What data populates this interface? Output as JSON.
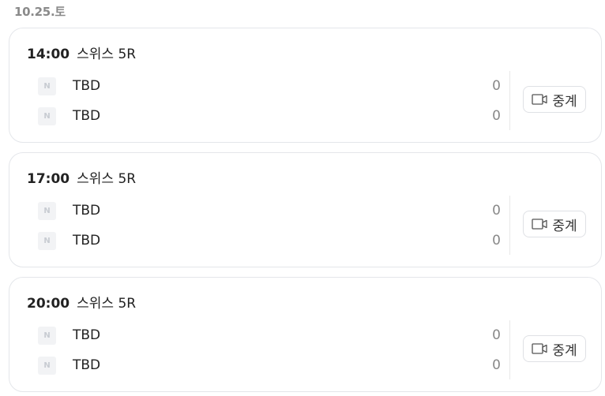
{
  "date": "10.25.토",
  "matches": [
    {
      "time": "14:00",
      "title": "스위스 5R",
      "teams": [
        {
          "logo_text": "N",
          "name": "TBD",
          "score": "0"
        },
        {
          "logo_text": "N",
          "name": "TBD",
          "score": "0"
        }
      ],
      "broadcast_label": "중계",
      "broadcast_icon": "video-camera-icon"
    },
    {
      "time": "17:00",
      "title": "스위스 5R",
      "teams": [
        {
          "logo_text": "N",
          "name": "TBD",
          "score": "0"
        },
        {
          "logo_text": "N",
          "name": "TBD",
          "score": "0"
        }
      ],
      "broadcast_label": "중계",
      "broadcast_icon": "video-camera-icon"
    },
    {
      "time": "20:00",
      "title": "스위스 5R",
      "teams": [
        {
          "logo_text": "N",
          "name": "TBD",
          "score": "0"
        },
        {
          "logo_text": "N",
          "name": "TBD",
          "score": "0"
        }
      ],
      "broadcast_label": "중계",
      "broadcast_icon": "video-camera-icon"
    }
  ]
}
